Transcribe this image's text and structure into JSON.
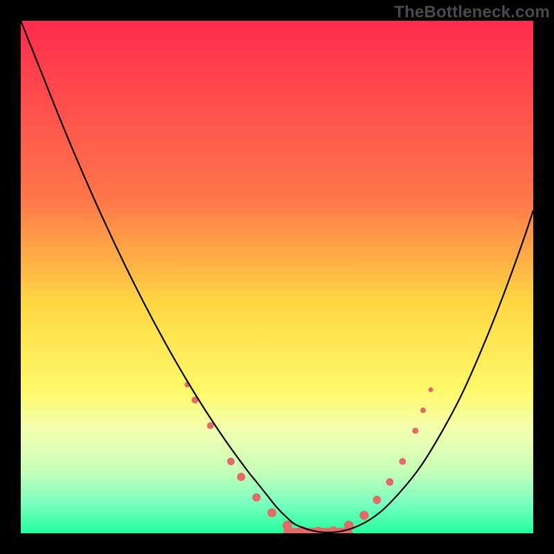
{
  "watermark": "TheBottleneck.com",
  "chart_data": {
    "type": "line",
    "title": "",
    "xlabel": "",
    "ylabel": "",
    "xlim": [
      0,
      100
    ],
    "ylim": [
      0,
      100
    ],
    "background_gradient": {
      "stops": [
        {
          "offset": 0,
          "color": "#ff2b4e"
        },
        {
          "offset": 35,
          "color": "#ff774a"
        },
        {
          "offset": 55,
          "color": "#ffd742"
        },
        {
          "offset": 72,
          "color": "#fff96a"
        },
        {
          "offset": 80,
          "color": "#f2ffb0"
        },
        {
          "offset": 88,
          "color": "#c6ffb8"
        },
        {
          "offset": 94,
          "color": "#7bffc0"
        },
        {
          "offset": 100,
          "color": "#23ff9d"
        }
      ]
    },
    "series": [
      {
        "name": "bottleneck-curve",
        "color": "#000000",
        "x": [
          0,
          4,
          8,
          12,
          16,
          20,
          24,
          28,
          32,
          36,
          40,
          44,
          46,
          48,
          50,
          52,
          54,
          58,
          62,
          66,
          70,
          74,
          78,
          82,
          86,
          90,
          94,
          98,
          100
        ],
        "y": [
          100,
          90,
          80,
          70.5,
          61.5,
          53,
          45,
          37.5,
          30.5,
          24,
          18,
          12.5,
          10,
          7.5,
          5,
          3,
          1.5,
          0.3,
          0.3,
          1.5,
          4,
          8,
          13,
          19.5,
          27,
          36,
          46,
          57,
          63
        ]
      }
    ],
    "markers": {
      "name": "curve-dots",
      "color": "#e46a6a",
      "radius_range": [
        3,
        10
      ],
      "points": [
        {
          "x": 32.5,
          "y": 29,
          "r": 4
        },
        {
          "x": 34,
          "y": 26,
          "r": 5
        },
        {
          "x": 37,
          "y": 21,
          "r": 5
        },
        {
          "x": 41,
          "y": 14,
          "r": 5.5
        },
        {
          "x": 43,
          "y": 11,
          "r": 6
        },
        {
          "x": 46,
          "y": 7,
          "r": 6
        },
        {
          "x": 49,
          "y": 4,
          "r": 6.5
        },
        {
          "x": 52,
          "y": 1.5,
          "r": 7
        },
        {
          "x": 55,
          "y": 0.4,
          "r": 7
        },
        {
          "x": 58,
          "y": 0.3,
          "r": 7
        },
        {
          "x": 61,
          "y": 0.4,
          "r": 7
        },
        {
          "x": 64,
          "y": 1.5,
          "r": 7
        },
        {
          "x": 67,
          "y": 3.5,
          "r": 6.5
        },
        {
          "x": 69.5,
          "y": 6.5,
          "r": 6
        },
        {
          "x": 72,
          "y": 10,
          "r": 5.5
        },
        {
          "x": 74.5,
          "y": 14,
          "r": 5
        },
        {
          "x": 77,
          "y": 20,
          "r": 4.5
        },
        {
          "x": 78.5,
          "y": 24,
          "r": 4
        },
        {
          "x": 80,
          "y": 28,
          "r": 3.5
        }
      ]
    },
    "flat_segment": {
      "name": "flat-bottom",
      "color": "#e46a6a",
      "x_start": 52,
      "x_end": 64,
      "y": 0.3,
      "thickness": 11
    }
  }
}
